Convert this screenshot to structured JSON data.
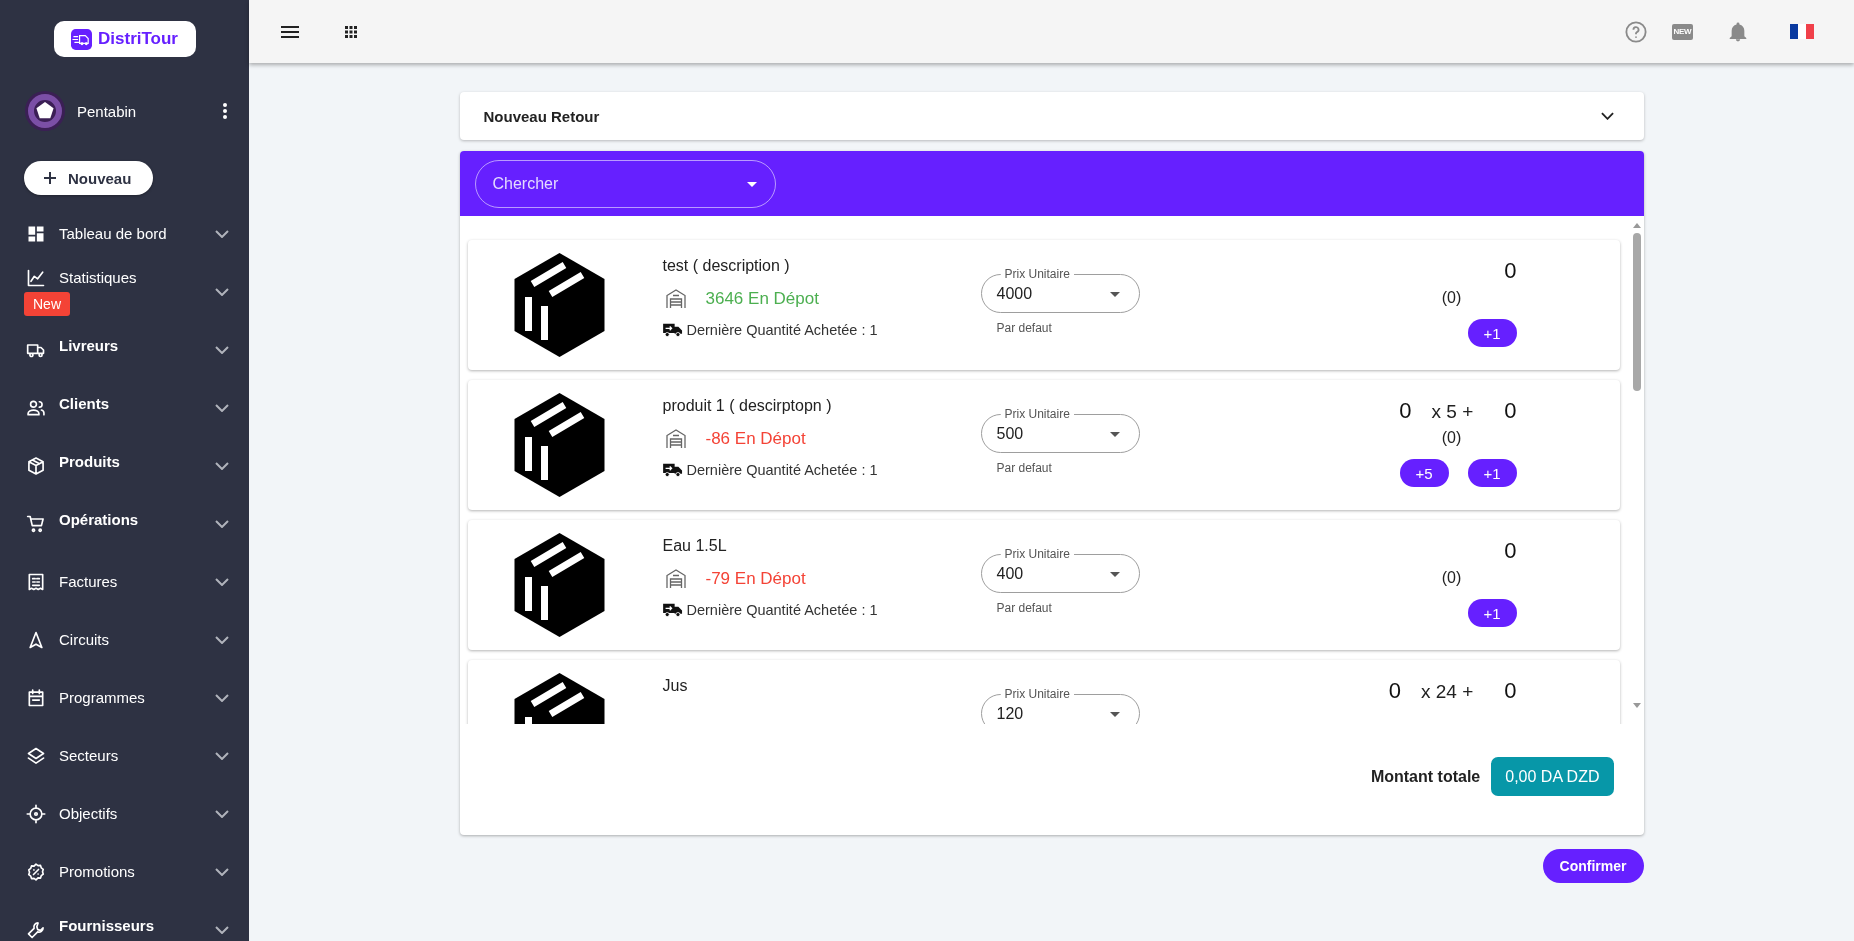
{
  "sidebar": {
    "logo": "DistriTour",
    "user": {
      "name": "Pentabin"
    },
    "new_button": "Nouveau",
    "items": [
      {
        "label": "Tableau de bord",
        "bold": false,
        "expanded": false
      },
      {
        "label": "Statistiques",
        "bold": false,
        "expanded": false,
        "badge": "New"
      },
      {
        "label": "Livreurs",
        "bold": true,
        "expanded": false
      },
      {
        "label": "Clients",
        "bold": true,
        "expanded": false
      },
      {
        "label": "Produits",
        "bold": true,
        "expanded": false
      },
      {
        "label": "Opérations",
        "bold": true,
        "expanded": false
      },
      {
        "label": "Factures",
        "bold": false,
        "expanded": false
      },
      {
        "label": "Circuits",
        "bold": false,
        "expanded": false
      },
      {
        "label": "Programmes",
        "bold": false,
        "expanded": false
      },
      {
        "label": "Secteurs",
        "bold": false,
        "expanded": false
      },
      {
        "label": "Objectifs",
        "bold": false,
        "expanded": false
      },
      {
        "label": "Promotions",
        "bold": false,
        "expanded": false
      },
      {
        "label": "Fournisseurs",
        "bold": true,
        "expanded": false
      }
    ]
  },
  "top_bar": {
    "new_label": "NEW"
  },
  "header": {
    "title": "Nouveau Retour",
    "expanded": false
  },
  "search": {
    "placeholder": "Chercher"
  },
  "products": [
    {
      "name": "test ( description )",
      "stock": {
        "text": "3646 En Dépot",
        "color": "#4caf50"
      },
      "last_purchase": "Dernière Quantité Achetée : 1",
      "price": {
        "label": "Prix Unitaire",
        "value": "4000",
        "helper": "Par defaut"
      },
      "quantity": [
        {
          "kind": "value",
          "text": "0"
        }
      ],
      "count": "(0)",
      "buttons": [
        "+1"
      ]
    },
    {
      "name": "produit 1 ( descirptopn )",
      "stock": {
        "text": "-86 En Dépot",
        "color": "#f44336"
      },
      "last_purchase": "Dernière Quantité Achetée : 1",
      "price": {
        "label": "Prix Unitaire",
        "value": "500",
        "helper": "Par defaut"
      },
      "quantity": [
        {
          "kind": "value",
          "text": "0"
        },
        {
          "kind": "multiplier",
          "text": "x 5 +"
        },
        {
          "kind": "value",
          "text": "0"
        }
      ],
      "count": "(0)",
      "buttons": [
        "+5",
        "+1"
      ]
    },
    {
      "name": "Eau 1.5L",
      "stock": {
        "text": "-79 En Dépot",
        "color": "#f44336"
      },
      "last_purchase": "Dernière Quantité Achetée : 1",
      "price": {
        "label": "Prix Unitaire",
        "value": "400",
        "helper": "Par defaut"
      },
      "quantity": [
        {
          "kind": "value",
          "text": "0"
        }
      ],
      "count": "(0)",
      "buttons": [
        "+1"
      ]
    },
    {
      "name": "Jus",
      "price": {
        "label": "Prix Unitaire",
        "value": "120"
      },
      "quantity": [
        {
          "kind": "value",
          "text": "0"
        },
        {
          "kind": "multiplier",
          "text": "x 24 +"
        },
        {
          "kind": "value",
          "text": "0"
        }
      ]
    }
  ],
  "total": {
    "label": "Montant totale",
    "amount": "0,00 DA DZD"
  },
  "confirm_button": "Confirmer"
}
